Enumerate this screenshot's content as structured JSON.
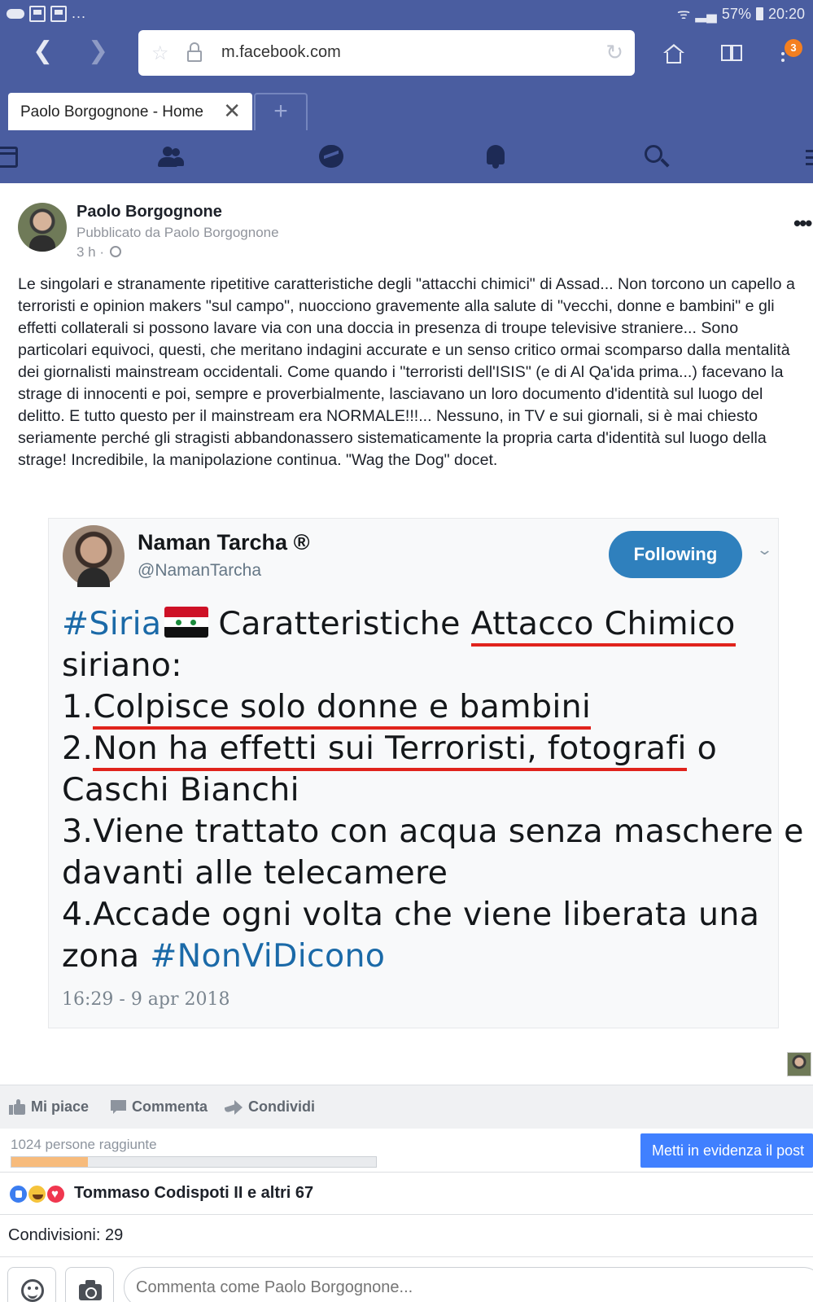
{
  "status_bar": {
    "battery": "57%",
    "clock": "20:20",
    "dots": "..."
  },
  "browser": {
    "url": "m.facebook.com",
    "tab_title": "Paolo Borgognone - Home",
    "tab_close": "✕",
    "new_tab": "+",
    "notification_count": "3"
  },
  "post": {
    "author": "Paolo Borgognone",
    "published_by": "Pubblicato da Paolo Borgognone",
    "time": "3 h ·",
    "options": "•••",
    "text": "Le singolari e stranamente ripetitive caratteristiche degli \"attacchi chimici\" di Assad... Non torcono un capello a terroristi e opinion makers \"sul campo\", nuocciono gravemente alla salute di \"vecchi, donne e bambini\" e gli effetti collaterali si possono lavare via con una doccia in presenza di troupe televisive straniere... Sono particolari equivoci, questi, che meritano indagini accurate e un senso critico ormai scomparso dalla mentalità dei giornalisti mainstream occidentali. Come quando i \"terroristi dell'ISIS\" (e di Al Qa'ida prima...) facevano la strage di innocenti e poi, sempre e proverbialmente, lasciavano un loro documento d'identità sul luogo del delitto. E tutto questo per il mainstream era NORMALE!!!... Nessuno, in TV e sui giornali, si è mai chiesto seriamente perché gli stragisti abbandonassero sistematicamente la propria carta d'identità sul luogo della strage! Incredibile, la manipolazione continua. \"Wag the Dog\" docet."
  },
  "tweet": {
    "name": "Naman Tarcha ®",
    "handle": "@NamanTarcha",
    "follow_label": "Following",
    "chevron": "⌄",
    "lines": {
      "l1_hash": "#Siria",
      "l1_text": "Caratteristiche ",
      "l1_ul": "Attacco Chimico",
      "l2": "siriano:",
      "l3_num": "1.",
      "l3_ul": "Colpisce solo donne e bambini ",
      "l4_num": "2.",
      "l4_ul": "Non ha effetti sui Terroristi, fotografi",
      "l4_rest": " o",
      "l5": "Caschi Bianchi",
      "l6": "3.Viene trattato con acqua senza maschere e",
      "l7": "davanti alle telecamere",
      "l8": "4.Accade ogni volta che viene liberata una",
      "l9_text": "zona ",
      "l9_hash": "#NonViDicono"
    },
    "date": "16:29 - 9 apr 2018"
  },
  "actions": {
    "like": "Mi piace",
    "comment": "Commenta",
    "share": "Condividi"
  },
  "reach": {
    "text": "1024 persone raggiunte",
    "progress_fraction": 0.21,
    "boost": "Metti in evidenza il post"
  },
  "reactions_text": "Tommaso Codispoti II e altri 67",
  "shares_text": "Condivisioni: 29",
  "comment_placeholder": "Commenta come Paolo Borgognone..."
}
